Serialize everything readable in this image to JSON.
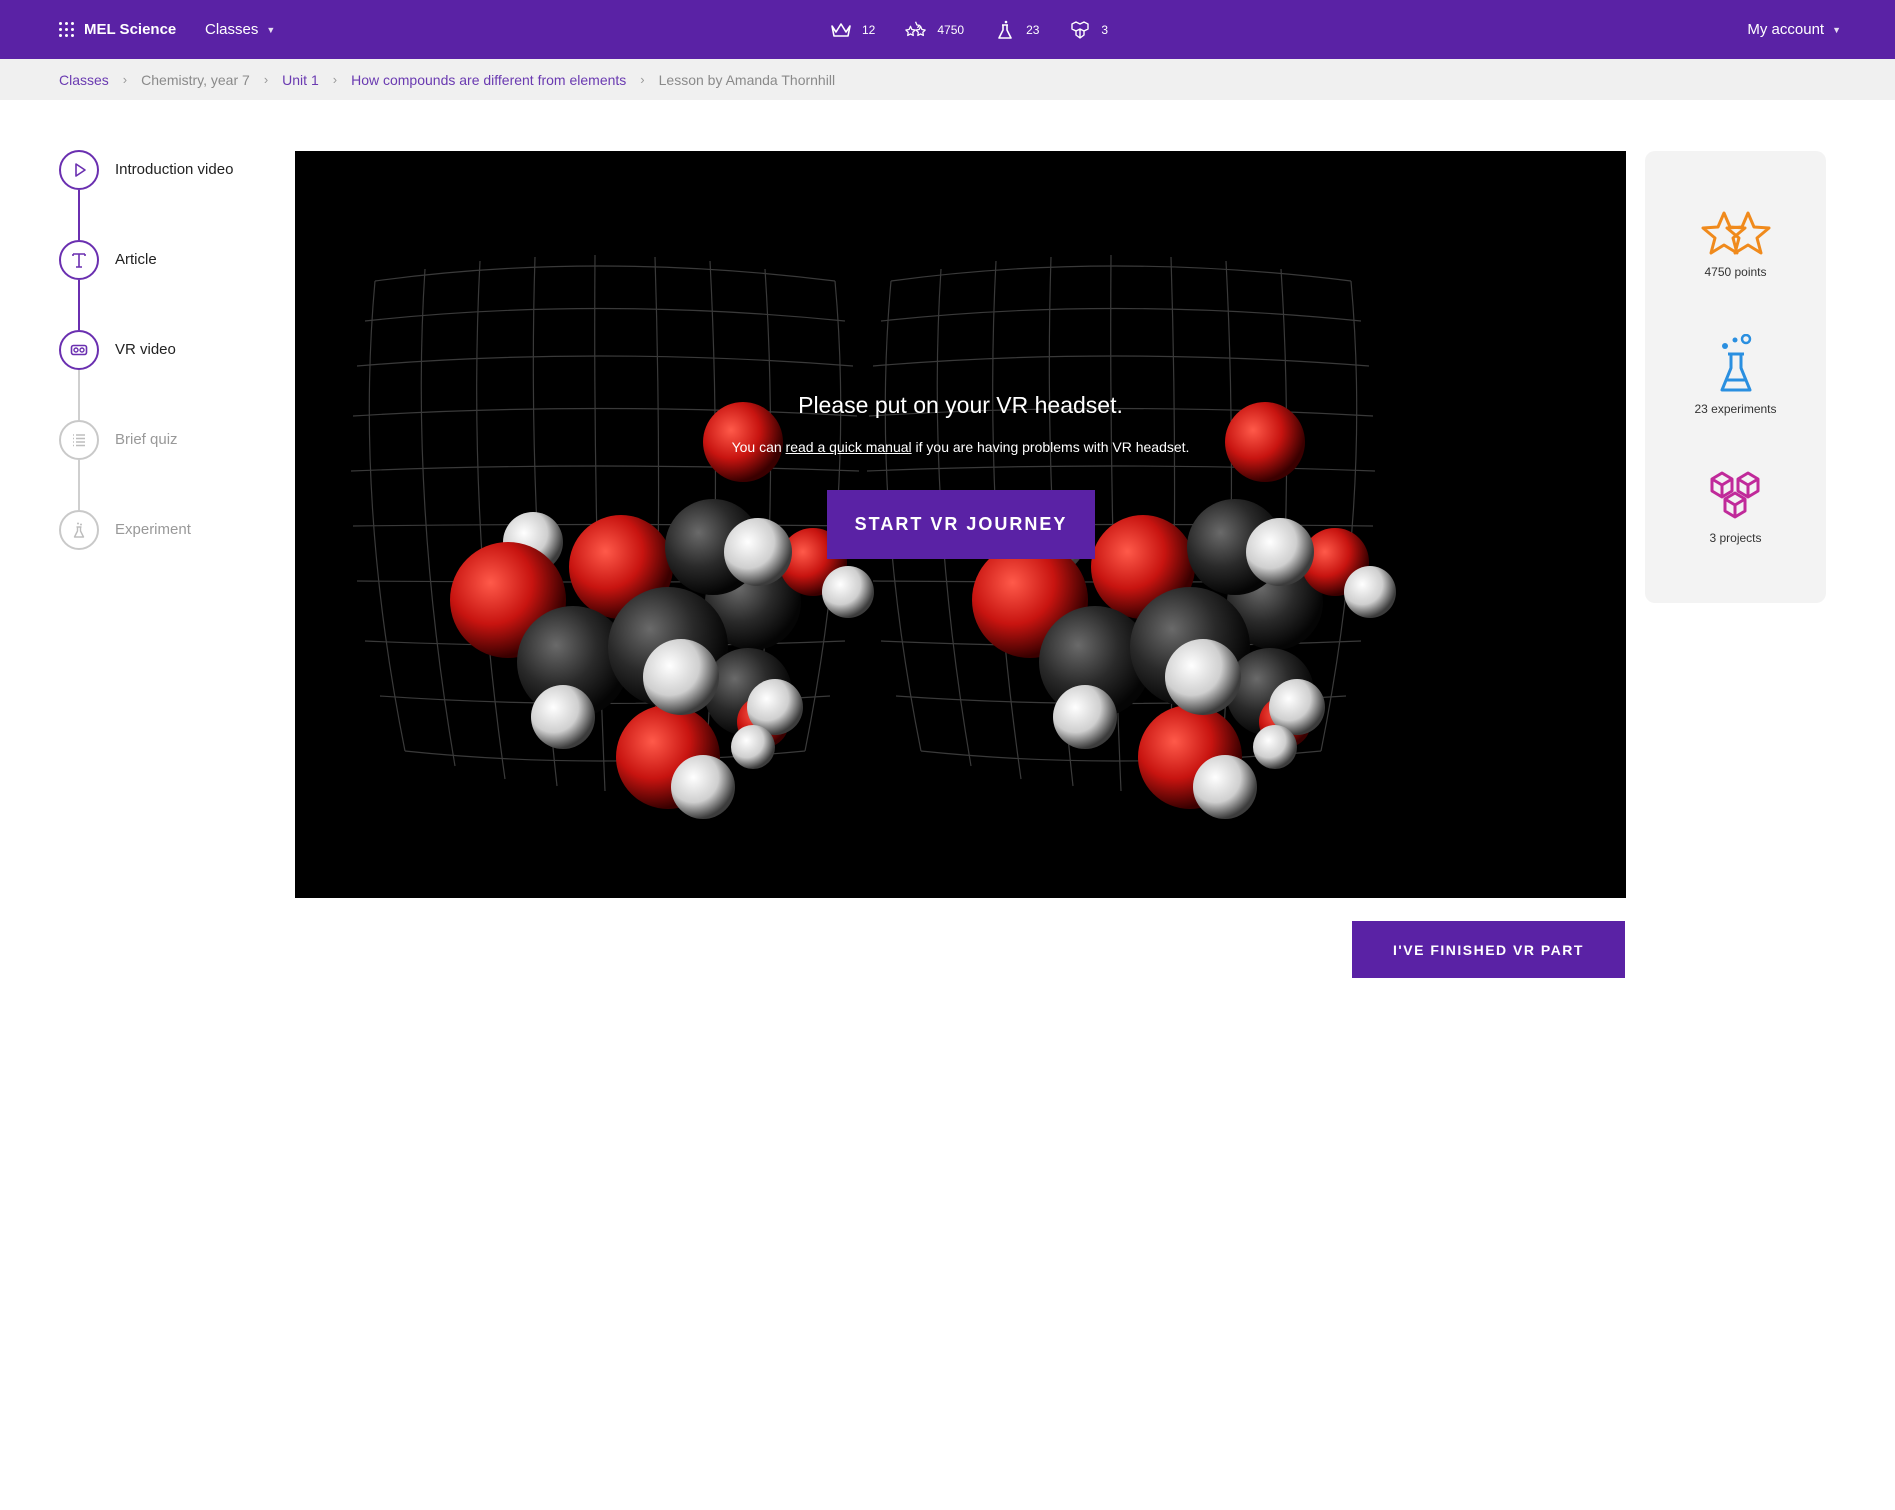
{
  "topbar": {
    "brand": "MEL Science",
    "classes_label": "Classes",
    "stats": [
      {
        "icon": "crown-icon",
        "value": "12"
      },
      {
        "icon": "stars-icon",
        "value": "4750"
      },
      {
        "icon": "flask-icon",
        "value": "23"
      },
      {
        "icon": "cubes-icon",
        "value": "3"
      }
    ],
    "account_label": "My account"
  },
  "breadcrumb": [
    {
      "label": "Classes",
      "link": true
    },
    {
      "label": "Chemistry, year 7",
      "link": false
    },
    {
      "label": "Unit 1",
      "link": true
    },
    {
      "label": "How compounds are different from elements",
      "link": true
    },
    {
      "label": "Lesson by Amanda Thornhill",
      "link": false
    }
  ],
  "steps": [
    {
      "label": "Introduction video",
      "icon": "play-icon",
      "state": "done"
    },
    {
      "label": "Article",
      "icon": "text-icon",
      "state": "done"
    },
    {
      "label": "VR video",
      "icon": "vr-headset-icon",
      "state": "current"
    },
    {
      "label": "Brief quiz",
      "icon": "list-icon",
      "state": "todo"
    },
    {
      "label": "Experiment",
      "icon": "experiment-icon",
      "state": "todo"
    }
  ],
  "viewer": {
    "title": "Please put on your VR headset.",
    "sub_prefix": "You can ",
    "sub_link": "read a quick manual",
    "sub_suffix": " if you are having problems with VR headset.",
    "start_button": "START VR JOURNEY"
  },
  "finish_button": "I'VE FINISHED VR PART",
  "panel": {
    "points": "4750 points",
    "experiments": "23 experiments",
    "projects": "3 projects"
  },
  "colors": {
    "brand": "#5a22a5",
    "stars": "#f08a1c",
    "experiments": "#2a8fe0",
    "projects": "#c02a9a"
  }
}
